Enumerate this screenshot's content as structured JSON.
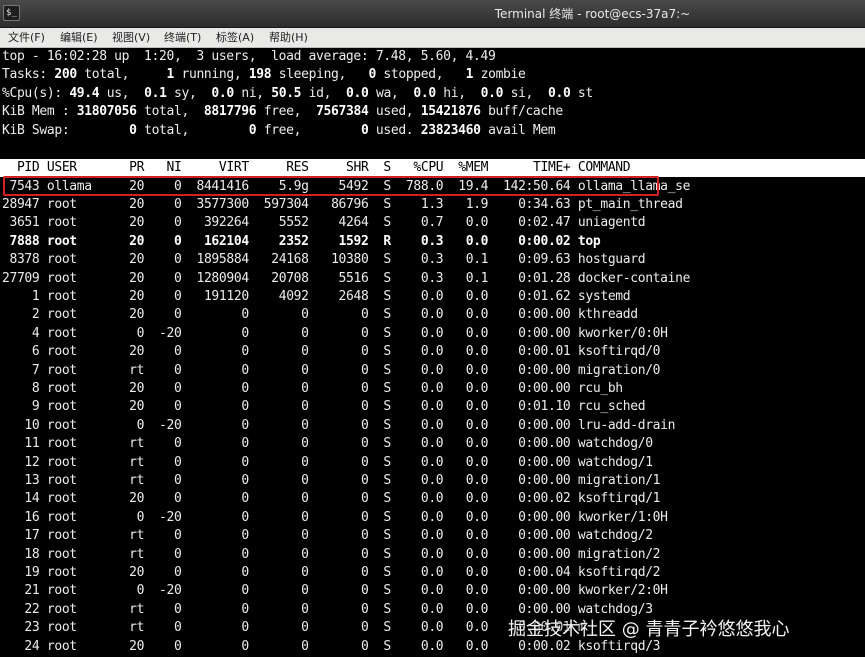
{
  "window": {
    "title": "Terminal 终端 - root@ecs-37a7:~",
    "icon": "terminal-icon"
  },
  "menu": [
    "文件(F)",
    "编辑(E)",
    "视图(V)",
    "终端(T)",
    "标签(A)",
    "帮助(H)"
  ],
  "summary": {
    "uptime_line": "top - 16:02:28 up  1:20,  3 users,  load average: 7.48, 5.60, 4.49",
    "tasks": {
      "label": "Tasks:",
      "total": "200",
      "running": "1",
      "sleeping": "198",
      "stopped": "0",
      "zombie": "1"
    },
    "cpu": {
      "label": "%Cpu(s):",
      "us": "49.4",
      "sy": "0.1",
      "ni": "0.0",
      "id": "50.5",
      "wa": "0.0",
      "hi": "0.0",
      "si": "0.0",
      "st": "0.0"
    },
    "mem": {
      "label": "KiB Mem :",
      "total": "31807056",
      "free": "8817796",
      "used": "7567384",
      "buff_cache": "15421876"
    },
    "swap": {
      "label": "KiB Swap:",
      "total": "0",
      "free": "0",
      "used": "0",
      "avail": "23823460"
    }
  },
  "columns": [
    "PID",
    "USER",
    "PR",
    "NI",
    "VIRT",
    "RES",
    "SHR",
    "S",
    "%CPU",
    "%MEM",
    "TIME+",
    "COMMAND"
  ],
  "processes": [
    {
      "pid": "7543",
      "user": "ollama",
      "pr": "20",
      "ni": "0",
      "virt": "8441416",
      "res": "5.9g",
      "shr": "5492",
      "s": "S",
      "cpu": "788.0",
      "mem": "19.4",
      "time": "142:50.64",
      "cmd": "ollama_llama_se",
      "highlight": true
    },
    {
      "pid": "28947",
      "user": "root",
      "pr": "20",
      "ni": "0",
      "virt": "3577300",
      "res": "597304",
      "shr": "86796",
      "s": "S",
      "cpu": "1.3",
      "mem": "1.9",
      "time": "0:34.63",
      "cmd": "pt_main_thread"
    },
    {
      "pid": "3651",
      "user": "root",
      "pr": "20",
      "ni": "0",
      "virt": "392264",
      "res": "5552",
      "shr": "4264",
      "s": "S",
      "cpu": "0.7",
      "mem": "0.0",
      "time": "0:02.47",
      "cmd": "uniagentd"
    },
    {
      "pid": "7888",
      "user": "root",
      "pr": "20",
      "ni": "0",
      "virt": "162104",
      "res": "2352",
      "shr": "1592",
      "s": "R",
      "cpu": "0.3",
      "mem": "0.0",
      "time": "0:00.02",
      "cmd": "top",
      "bold": true
    },
    {
      "pid": "8378",
      "user": "root",
      "pr": "20",
      "ni": "0",
      "virt": "1895884",
      "res": "24168",
      "shr": "10380",
      "s": "S",
      "cpu": "0.3",
      "mem": "0.1",
      "time": "0:09.63",
      "cmd": "hostguard"
    },
    {
      "pid": "27709",
      "user": "root",
      "pr": "20",
      "ni": "0",
      "virt": "1280904",
      "res": "20708",
      "shr": "5516",
      "s": "S",
      "cpu": "0.3",
      "mem": "0.1",
      "time": "0:01.28",
      "cmd": "docker-containe"
    },
    {
      "pid": "1",
      "user": "root",
      "pr": "20",
      "ni": "0",
      "virt": "191120",
      "res": "4092",
      "shr": "2648",
      "s": "S",
      "cpu": "0.0",
      "mem": "0.0",
      "time": "0:01.62",
      "cmd": "systemd"
    },
    {
      "pid": "2",
      "user": "root",
      "pr": "20",
      "ni": "0",
      "virt": "0",
      "res": "0",
      "shr": "0",
      "s": "S",
      "cpu": "0.0",
      "mem": "0.0",
      "time": "0:00.00",
      "cmd": "kthreadd"
    },
    {
      "pid": "4",
      "user": "root",
      "pr": "0",
      "ni": "-20",
      "virt": "0",
      "res": "0",
      "shr": "0",
      "s": "S",
      "cpu": "0.0",
      "mem": "0.0",
      "time": "0:00.00",
      "cmd": "kworker/0:0H"
    },
    {
      "pid": "6",
      "user": "root",
      "pr": "20",
      "ni": "0",
      "virt": "0",
      "res": "0",
      "shr": "0",
      "s": "S",
      "cpu": "0.0",
      "mem": "0.0",
      "time": "0:00.01",
      "cmd": "ksoftirqd/0"
    },
    {
      "pid": "7",
      "user": "root",
      "pr": "rt",
      "ni": "0",
      "virt": "0",
      "res": "0",
      "shr": "0",
      "s": "S",
      "cpu": "0.0",
      "mem": "0.0",
      "time": "0:00.00",
      "cmd": "migration/0"
    },
    {
      "pid": "8",
      "user": "root",
      "pr": "20",
      "ni": "0",
      "virt": "0",
      "res": "0",
      "shr": "0",
      "s": "S",
      "cpu": "0.0",
      "mem": "0.0",
      "time": "0:00.00",
      "cmd": "rcu_bh"
    },
    {
      "pid": "9",
      "user": "root",
      "pr": "20",
      "ni": "0",
      "virt": "0",
      "res": "0",
      "shr": "0",
      "s": "S",
      "cpu": "0.0",
      "mem": "0.0",
      "time": "0:01.10",
      "cmd": "rcu_sched"
    },
    {
      "pid": "10",
      "user": "root",
      "pr": "0",
      "ni": "-20",
      "virt": "0",
      "res": "0",
      "shr": "0",
      "s": "S",
      "cpu": "0.0",
      "mem": "0.0",
      "time": "0:00.00",
      "cmd": "lru-add-drain"
    },
    {
      "pid": "11",
      "user": "root",
      "pr": "rt",
      "ni": "0",
      "virt": "0",
      "res": "0",
      "shr": "0",
      "s": "S",
      "cpu": "0.0",
      "mem": "0.0",
      "time": "0:00.00",
      "cmd": "watchdog/0"
    },
    {
      "pid": "12",
      "user": "root",
      "pr": "rt",
      "ni": "0",
      "virt": "0",
      "res": "0",
      "shr": "0",
      "s": "S",
      "cpu": "0.0",
      "mem": "0.0",
      "time": "0:00.00",
      "cmd": "watchdog/1"
    },
    {
      "pid": "13",
      "user": "root",
      "pr": "rt",
      "ni": "0",
      "virt": "0",
      "res": "0",
      "shr": "0",
      "s": "S",
      "cpu": "0.0",
      "mem": "0.0",
      "time": "0:00.00",
      "cmd": "migration/1"
    },
    {
      "pid": "14",
      "user": "root",
      "pr": "20",
      "ni": "0",
      "virt": "0",
      "res": "0",
      "shr": "0",
      "s": "S",
      "cpu": "0.0",
      "mem": "0.0",
      "time": "0:00.02",
      "cmd": "ksoftirqd/1"
    },
    {
      "pid": "16",
      "user": "root",
      "pr": "0",
      "ni": "-20",
      "virt": "0",
      "res": "0",
      "shr": "0",
      "s": "S",
      "cpu": "0.0",
      "mem": "0.0",
      "time": "0:00.00",
      "cmd": "kworker/1:0H"
    },
    {
      "pid": "17",
      "user": "root",
      "pr": "rt",
      "ni": "0",
      "virt": "0",
      "res": "0",
      "shr": "0",
      "s": "S",
      "cpu": "0.0",
      "mem": "0.0",
      "time": "0:00.00",
      "cmd": "watchdog/2"
    },
    {
      "pid": "18",
      "user": "root",
      "pr": "rt",
      "ni": "0",
      "virt": "0",
      "res": "0",
      "shr": "0",
      "s": "S",
      "cpu": "0.0",
      "mem": "0.0",
      "time": "0:00.00",
      "cmd": "migration/2"
    },
    {
      "pid": "19",
      "user": "root",
      "pr": "20",
      "ni": "0",
      "virt": "0",
      "res": "0",
      "shr": "0",
      "s": "S",
      "cpu": "0.0",
      "mem": "0.0",
      "time": "0:00.04",
      "cmd": "ksoftirqd/2"
    },
    {
      "pid": "21",
      "user": "root",
      "pr": "0",
      "ni": "-20",
      "virt": "0",
      "res": "0",
      "shr": "0",
      "s": "S",
      "cpu": "0.0",
      "mem": "0.0",
      "time": "0:00.00",
      "cmd": "kworker/2:0H"
    },
    {
      "pid": "22",
      "user": "root",
      "pr": "rt",
      "ni": "0",
      "virt": "0",
      "res": "0",
      "shr": "0",
      "s": "S",
      "cpu": "0.0",
      "mem": "0.0",
      "time": "0:00.00",
      "cmd": "watchdog/3"
    },
    {
      "pid": "23",
      "user": "root",
      "pr": "rt",
      "ni": "0",
      "virt": "0",
      "res": "0",
      "shr": "0",
      "s": "S",
      "cpu": "0.0",
      "mem": "0.0",
      "time": "0:00.01",
      "cmd": "m"
    },
    {
      "pid": "24",
      "user": "root",
      "pr": "20",
      "ni": "0",
      "virt": "0",
      "res": "0",
      "shr": "0",
      "s": "S",
      "cpu": "0.0",
      "mem": "0.0",
      "time": "0:00.02",
      "cmd": "ksoftirqd/3"
    }
  ],
  "watermark": "掘金技术社区 @ 青青子衿悠悠我心",
  "colors": {
    "highlight_box": "#d21f1f",
    "terminal_bg": "#000000",
    "header_bg": "#ffffff"
  }
}
